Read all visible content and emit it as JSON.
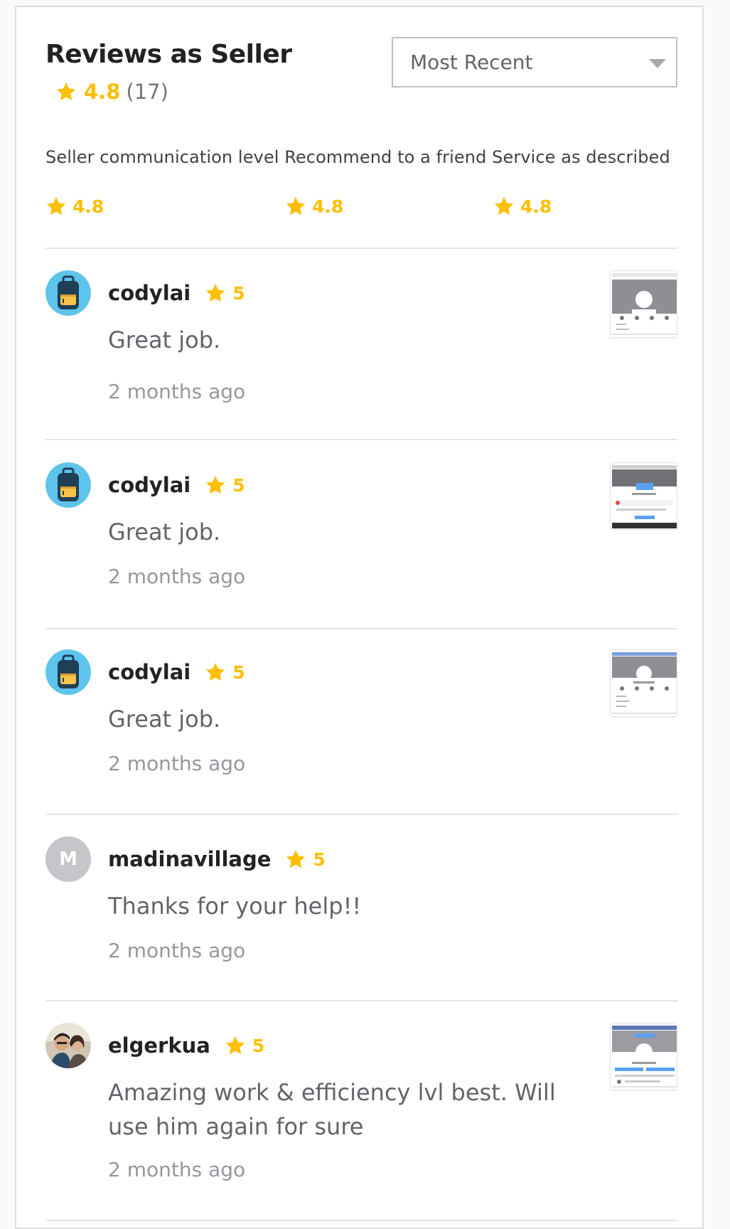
{
  "header": {
    "title": "Reviews as Seller",
    "rating": "4.8",
    "count": "(17)",
    "sort_selected": "Most Recent"
  },
  "breakdown": {
    "labels": "Seller communication level Recommend to a friend Service as described",
    "communication": "4.8",
    "recommend": "4.8",
    "service": "4.8"
  },
  "colors": {
    "star": "#ffbe00",
    "title": "#222222",
    "muted": "#95979d"
  },
  "reviews": [
    {
      "username": "codylai",
      "rating": "5",
      "text": "Great job.",
      "time": "2 months ago",
      "avatar": "backpack-avatar",
      "has_attachment": true
    },
    {
      "username": "codylai",
      "rating": "5",
      "text": "Great job.",
      "time": "2 months ago",
      "avatar": "backpack-avatar",
      "has_attachment": true
    },
    {
      "username": "codylai",
      "rating": "5",
      "text": "Great job.",
      "time": "2 months ago",
      "avatar": "backpack-avatar",
      "has_attachment": true
    },
    {
      "username": "madinavillage",
      "rating": "5",
      "text": "Thanks for your help!!",
      "time": "2 months ago",
      "avatar_letter": "M",
      "has_attachment": false
    },
    {
      "username": "elgerkua",
      "rating": "5",
      "text": "Amazing work & efficiency lvl best. Will use him again for sure",
      "time": "2 months ago",
      "avatar": "photo-avatar",
      "has_attachment": true
    }
  ]
}
